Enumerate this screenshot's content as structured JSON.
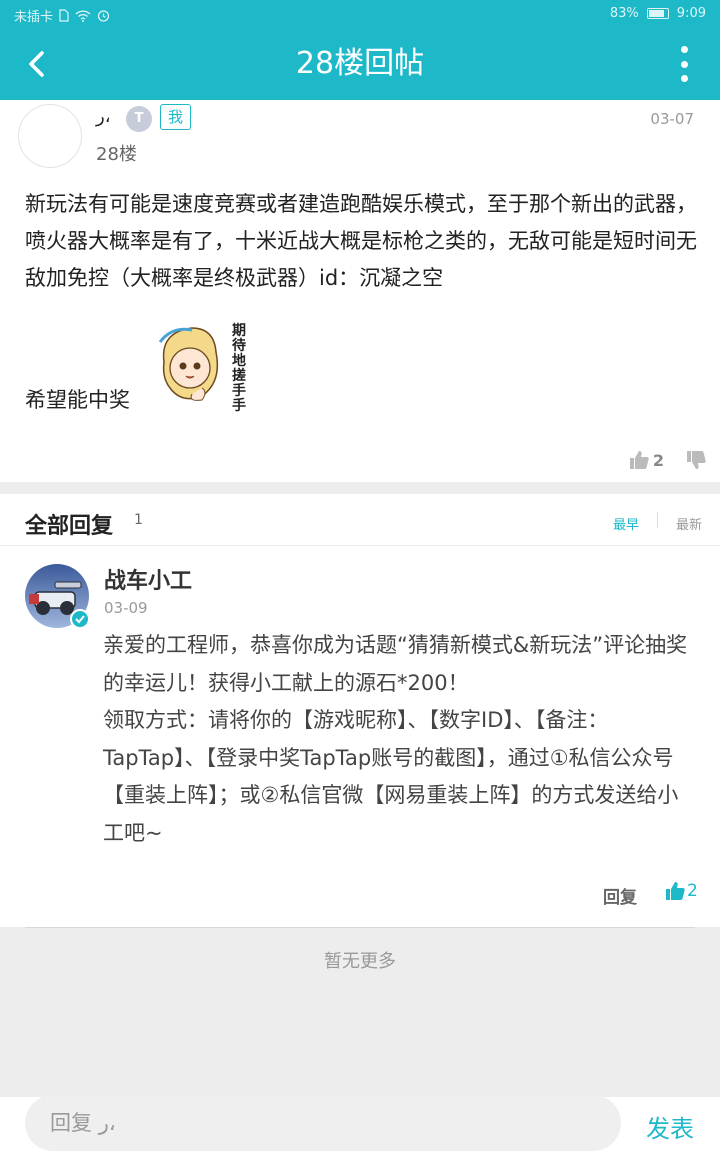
{
  "status_bar": {
    "carrier": "未插卡",
    "battery_percent": "83%",
    "time": "9:09"
  },
  "app_bar": {
    "title": "28楼回帖",
    "back_icon": "chevron-left-icon",
    "more_icon": "more-vertical-icon"
  },
  "post": {
    "username": "ر،",
    "level_badge": "T",
    "me_tag": "我",
    "floor": "28楼",
    "date": "03-07",
    "text": "新玩法有可能是速度竞赛或者建造跑酷娱乐模式，至于那个新出的武器，喷火器大概率是有了，十米近战大概是标枪之类的，无敌可能是短时间无敌加免控（大概率是终极武器）id：沉凝之空",
    "text2": "希望能中奖",
    "sticker_text": "期待地搓手手",
    "like_count": "2"
  },
  "replies": {
    "title": "全部回复",
    "count": "1",
    "sort_earliest": "最早",
    "sort_newest": "最新",
    "items": [
      {
        "name": "战车小工",
        "date": "03-09",
        "text": "亲爱的工程师，恭喜你成为话题“猜猜新模式&新玩法”评论抽奖的幸运儿！获得小工献上的源石*200！\n领取方式：请将你的【游戏昵称】、【数字ID】、【备注：TapTap】、【登录中奖TapTap账号的截图】，通过①私信公众号【重装上阵】；或②私信官微【网易重装上阵】的方式发送给小工吧~",
        "reply_label": "回复",
        "like_count": "2"
      }
    ],
    "no_more": "暂无更多"
  },
  "composer": {
    "placeholder": "回复 ر،",
    "send_label": "发表"
  },
  "colors": {
    "accent": "#1eb9c9",
    "divider": "#ededed"
  }
}
